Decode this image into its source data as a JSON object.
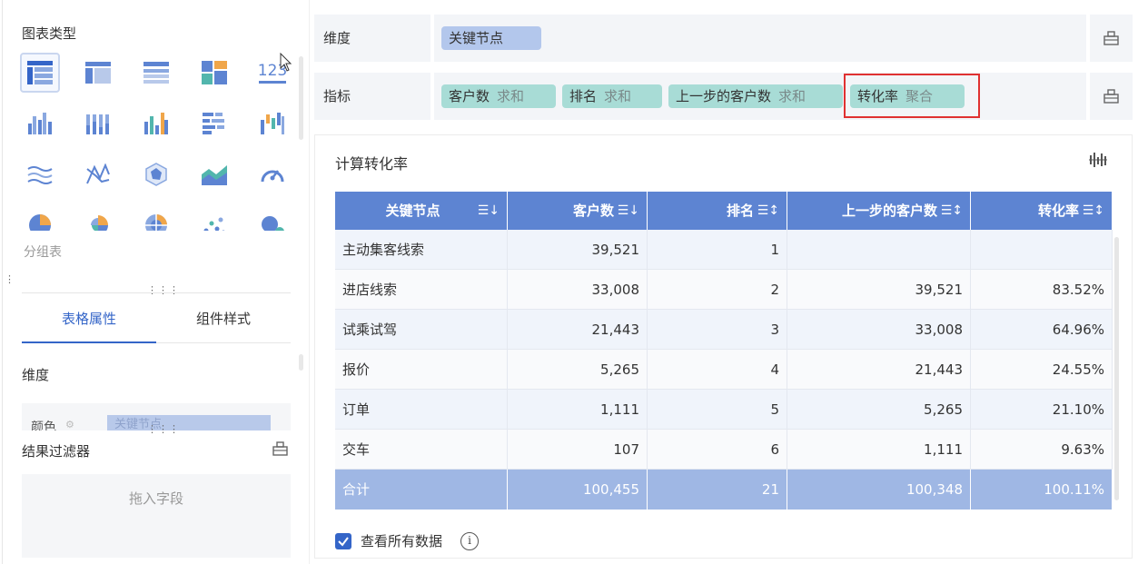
{
  "left_panel": {
    "chart_type_title": "图表类型",
    "chart_icons": [
      "table-detail-icon",
      "table-cross-icon",
      "table-group-icon",
      "table-card-icon",
      "kpi-number-icon",
      "grouped-bar-icon",
      "stacked-column-icon",
      "multi-column-icon",
      "bar-horizontal-icon",
      "waterfall-icon",
      "line-wave-icon",
      "radar-line-icon",
      "radar-icon",
      "area-chart-icon",
      "gauge-icon",
      "pie-chart-icon",
      "rose-chart-icon",
      "sunburst-icon",
      "scatter-icon",
      "bubble-icon"
    ],
    "selected_chart_icon": "table-detail-icon",
    "kpi_text": "123",
    "hover_label": "分组表",
    "tabs": [
      "表格属性",
      "组件样式"
    ],
    "active_tab": "表格属性",
    "dimension_label": "维度",
    "color_label": "颜色",
    "color_field": "关键节点",
    "result_filter_title": "结果过滤器",
    "drop_zone_text": "拖入字段"
  },
  "fields": {
    "dimension_label": "维度",
    "dimension_pill": "关键节点",
    "metric_label": "指标",
    "metric_pills": [
      {
        "name": "客户数",
        "agg": "求和"
      },
      {
        "name": "排名",
        "agg": "求和"
      },
      {
        "name": "上一步的客户数",
        "agg": "求和"
      },
      {
        "name": "转化率",
        "agg": "聚合"
      }
    ]
  },
  "table_card": {
    "title": "计算转化率",
    "columns": [
      "关键节点",
      "客户数",
      "排名",
      "上一步的客户数",
      "转化率"
    ],
    "sort_symbols": [
      "☰↓",
      "☰↓",
      "☰↕",
      "☰↕",
      "☰↕"
    ],
    "rows": [
      [
        "主动集客线索",
        "39,521",
        "1",
        "",
        ""
      ],
      [
        "进店线索",
        "33,008",
        "2",
        "39,521",
        "83.52%"
      ],
      [
        "试乘试驾",
        "21,443",
        "3",
        "33,008",
        "64.96%"
      ],
      [
        "报价",
        "5,265",
        "4",
        "21,443",
        "24.55%"
      ],
      [
        "订单",
        "1,111",
        "5",
        "5,265",
        "21.10%"
      ],
      [
        "交车",
        "107",
        "6",
        "1,111",
        "9.63%"
      ]
    ],
    "total_row": [
      "合计",
      "100,455",
      "21",
      "100,348",
      "100.11%"
    ],
    "view_all_label": "查看所有数据",
    "view_all_checked": true,
    "info_symbol": "i"
  },
  "colors": {
    "accent": "#3465c8",
    "header_bg": "#5d84d2",
    "total_bg": "#9fb7e4",
    "dim_pill": "#b3c7ec",
    "metric_pill": "#a8dcd6",
    "highlight_border": "#e03131"
  }
}
